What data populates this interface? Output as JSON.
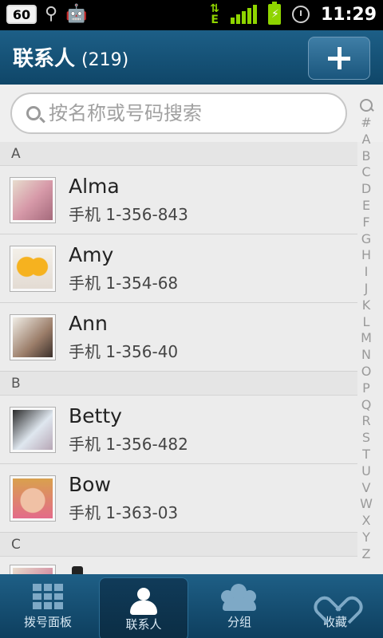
{
  "status_bar": {
    "badge": "60",
    "network_label": "E",
    "time": "11:29"
  },
  "header": {
    "title": "联系人",
    "count": "(219)"
  },
  "search": {
    "placeholder": "按名称或号码搜索"
  },
  "sections": [
    {
      "letter": "A",
      "contacts": [
        {
          "name": "Alma",
          "phone_label": "手机",
          "phone": "1-356-843"
        },
        {
          "name": "Amy",
          "phone_label": "手机",
          "phone": "1-354-68"
        },
        {
          "name": "Ann",
          "phone_label": "手机",
          "phone": "1-356-40"
        }
      ]
    },
    {
      "letter": "B",
      "contacts": [
        {
          "name": "Betty",
          "phone_label": "手机",
          "phone": "1-356-482"
        },
        {
          "name": "Bow",
          "phone_label": "手机",
          "phone": "1-363-03"
        }
      ]
    },
    {
      "letter": "C",
      "contacts": []
    }
  ],
  "alphabet_index": [
    "#",
    "A",
    "B",
    "C",
    "D",
    "E",
    "F",
    "G",
    "H",
    "I",
    "J",
    "K",
    "L",
    "M",
    "N",
    "O",
    "P",
    "Q",
    "R",
    "S",
    "T",
    "U",
    "V",
    "W",
    "X",
    "Y",
    "Z"
  ],
  "tabs": [
    {
      "label": "拨号面板",
      "icon": "dialpad-icon"
    },
    {
      "label": "联系人",
      "icon": "person-icon"
    },
    {
      "label": "分组",
      "icon": "group-icon"
    },
    {
      "label": "收藏",
      "icon": "heart-icon"
    }
  ],
  "colors": {
    "header_blue": "#1d5f87",
    "accent_green": "#8fd400",
    "list_bg": "#ececec"
  }
}
